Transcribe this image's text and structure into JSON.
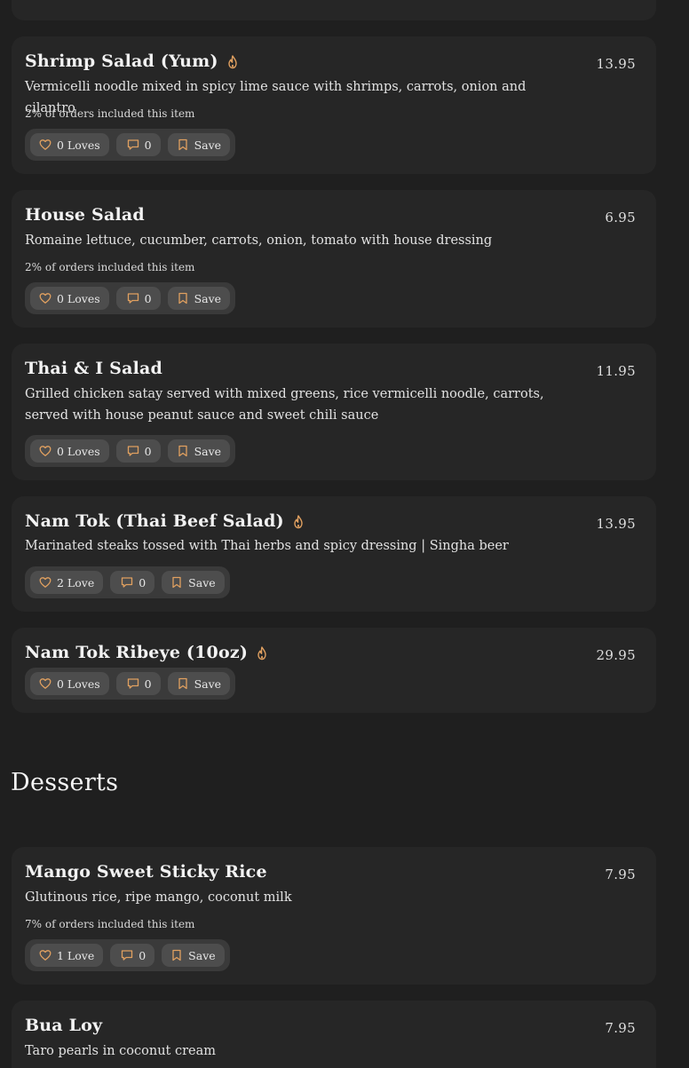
{
  "colors": {
    "background": "#1f1f1f",
    "card": "#262626",
    "pill": "#4d4d4d",
    "accent_icon": "#e0a060"
  },
  "sections": [
    {
      "items": [
        {
          "title": "Shrimp Salad (Yum)",
          "spicy": true,
          "price": "13.95",
          "description": "Vermicelli noodle mixed in spicy lime sauce with shrimps, carrots, onion and cilantro",
          "stat": "2% of orders included this item",
          "loves": "0 Loves",
          "comments": "0",
          "save": "Save"
        },
        {
          "title": "House Salad",
          "spicy": false,
          "price": "6.95",
          "description": "Romaine lettuce, cucumber, carrots, onion, tomato with house dressing",
          "stat": "2% of orders included this item",
          "loves": "0 Loves",
          "comments": "0",
          "save": "Save"
        },
        {
          "title": "Thai & I Salad",
          "spicy": false,
          "price": "11.95",
          "description": "Grilled chicken satay served with mixed greens, rice vermicelli noodle, carrots, served with house peanut sauce and sweet chili sauce",
          "loves": "0 Loves",
          "comments": "0",
          "save": "Save"
        },
        {
          "title": "Nam Tok (Thai Beef Salad)",
          "spicy": true,
          "price": "13.95",
          "description": "Marinated steaks tossed with Thai herbs and spicy dressing | Singha beer",
          "loves": "2 Love",
          "comments": "0",
          "save": "Save"
        },
        {
          "title": "Nam Tok Ribeye (10oz)",
          "spicy": true,
          "price": "29.95",
          "loves": "0 Loves",
          "comments": "0",
          "save": "Save"
        }
      ]
    },
    {
      "title": "Desserts",
      "items": [
        {
          "title": "Mango Sweet Sticky Rice",
          "spicy": false,
          "price": "7.95",
          "description": "Glutinous rice, ripe mango, coconut milk",
          "stat": "7% of orders included this item",
          "loves": "1 Love",
          "comments": "0",
          "save": "Save"
        },
        {
          "title": "Bua Loy",
          "spicy": false,
          "price": "7.95",
          "description": "Taro pearls in coconut cream"
        }
      ]
    }
  ]
}
